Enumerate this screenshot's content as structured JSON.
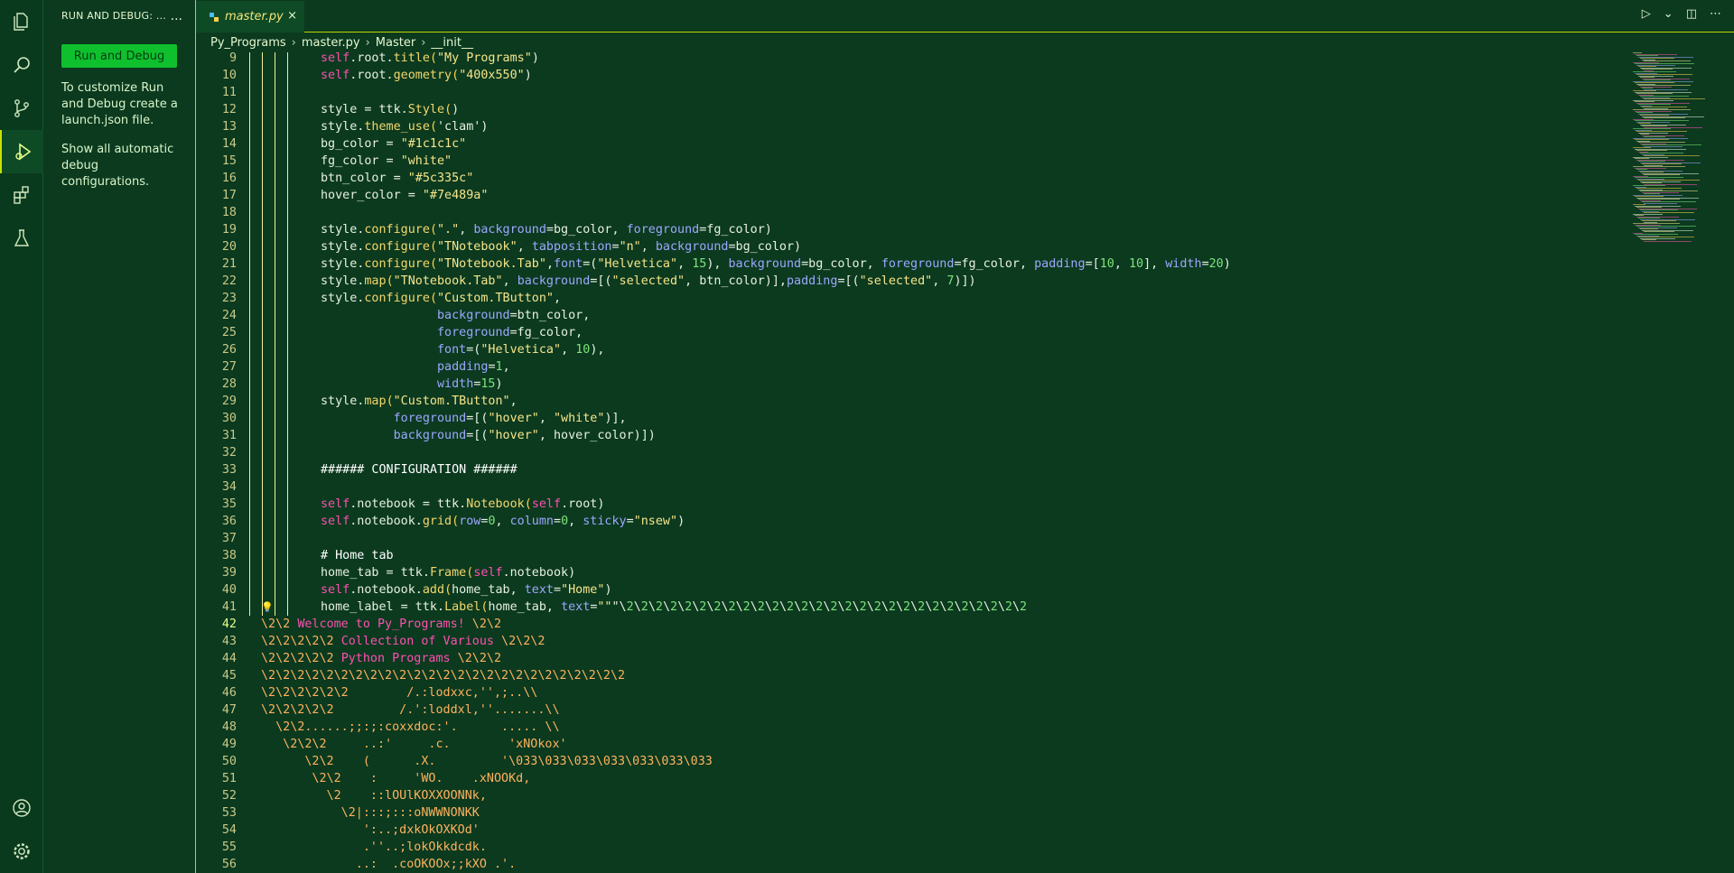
{
  "colors": {
    "accent": "#c2d400",
    "button": "#0fc02e",
    "background": "#0b3a1f"
  },
  "sidebar": {
    "header": "RUN AND DEBUG: ...",
    "more": "...",
    "run_button": "Run and Debug",
    "help_text": "To customize Run and Debug create a launch.json file.",
    "show_all": "Show all automatic debug configurations."
  },
  "tab": {
    "name": "master.py",
    "close": "×",
    "icon": "python-icon"
  },
  "breadcrumb": {
    "items": [
      "Py_Programs",
      "master.py",
      "Master",
      "__init__"
    ]
  },
  "editor": {
    "current_line": "42",
    "lines": [
      {
        "n": "9",
        "t": "self.root.title(\"My Programs\")"
      },
      {
        "n": "10",
        "t": "self.root.geometry(\"400x550\")"
      },
      {
        "n": "11",
        "t": ""
      },
      {
        "n": "12",
        "t": "style = ttk.Style()"
      },
      {
        "n": "13",
        "t": "style.theme_use('clam')"
      },
      {
        "n": "14",
        "t": "bg_color = \"#1c1c1c\""
      },
      {
        "n": "15",
        "t": "fg_color = \"white\""
      },
      {
        "n": "16",
        "t": "btn_color = \"#5c335c\""
      },
      {
        "n": "17",
        "t": "hover_color = \"#7e489a\""
      },
      {
        "n": "18",
        "t": ""
      },
      {
        "n": "19",
        "t": "style.configure(\".\", background=bg_color, foreground=fg_color)"
      },
      {
        "n": "20",
        "t": "style.configure(\"TNotebook\", tabposition=\"n\", background=bg_color)"
      },
      {
        "n": "21",
        "t": "style.configure(\"TNotebook.Tab\",font=(\"Helvetica\", 15), background=bg_color, foreground=fg_color, padding=[10, 10], width=20)"
      },
      {
        "n": "22",
        "t": "style.map(\"TNotebook.Tab\", background=[(\"selected\", btn_color)],padding=[(\"selected\", 7)])"
      },
      {
        "n": "23",
        "t": "style.configure(\"Custom.TButton\","
      },
      {
        "n": "24",
        "t": "                background=btn_color,"
      },
      {
        "n": "25",
        "t": "                foreground=fg_color,"
      },
      {
        "n": "26",
        "t": "                font=(\"Helvetica\", 10),"
      },
      {
        "n": "27",
        "t": "                padding=1,"
      },
      {
        "n": "28",
        "t": "                width=15)"
      },
      {
        "n": "29",
        "t": "style.map(\"Custom.TButton\","
      },
      {
        "n": "30",
        "t": "          foreground=[(\"hover\", \"white\")],"
      },
      {
        "n": "31",
        "t": "          background=[(\"hover\", hover_color)])"
      },
      {
        "n": "32",
        "t": ""
      },
      {
        "n": "33",
        "t": "###### CONFIGURATION ######"
      },
      {
        "n": "34",
        "t": ""
      },
      {
        "n": "35",
        "t": "self.notebook = ttk.Notebook(self.root)"
      },
      {
        "n": "36",
        "t": "self.notebook.grid(row=0, column=0, sticky=\"nsew\")"
      },
      {
        "n": "37",
        "t": ""
      },
      {
        "n": "38",
        "t": "# Home tab"
      },
      {
        "n": "39",
        "t": "home_tab = ttk.Frame(self.notebook)"
      },
      {
        "n": "40",
        "t": "self.notebook.add(home_tab, text=\"Home\")"
      },
      {
        "n": "41",
        "t": "home_label = ttk.Label(home_tab, text=\"\"\"\\2\\2\\2\\2\\2\\2\\2\\2\\2\\2\\2\\2\\2\\2\\2\\2\\2\\2\\2\\2\\2\\2\\2\\2\\2\\2\\2\\2"
      },
      {
        "n": "42",
        "t": "\\2\\2 Welcome to Py_Programs! \\2\\2"
      },
      {
        "n": "43",
        "t": "\\2\\2\\2\\2\\2 Collection of Various \\2\\2\\2"
      },
      {
        "n": "44",
        "t": "\\2\\2\\2\\2\\2 Python Programs \\2\\2\\2"
      },
      {
        "n": "45",
        "t": "\\2\\2\\2\\2\\2\\2\\2\\2\\2\\2\\2\\2\\2\\2\\2\\2\\2\\2\\2\\2\\2\\2\\2\\2\\2"
      },
      {
        "n": "46",
        "t": "\\2\\2\\2\\2\\2\\2        /.:lodxxc,'',;..\\\\"
      },
      {
        "n": "47",
        "t": "\\2\\2\\2\\2\\2         /.':loddxl,''.......\\\\"
      },
      {
        "n": "48",
        "t": "  \\2\\2......;;:;:coxxdoc:'.      ..... \\\\"
      },
      {
        "n": "49",
        "t": "   \\2\\2\\2     ..:'     .c.        'xNOkox'"
      },
      {
        "n": "50",
        "t": "      \\2\\2    (      .X.         '\\033\\033\\033\\033\\033\\033\\033"
      },
      {
        "n": "51",
        "t": "       \\2\\2    :     'WO.    .xNOOKd,"
      },
      {
        "n": "52",
        "t": "         \\2    ::lOUlKOXXOONNk,"
      },
      {
        "n": "53",
        "t": "           \\2|:::;:::oNWWNONKK"
      },
      {
        "n": "54",
        "t": "              ':..;dxkOkOXKOd'"
      },
      {
        "n": "55",
        "t": "              .''..;lokOkkdcdk."
      },
      {
        "n": "56",
        "t": "             ..:  .coOKOOx;;kXO .'."
      }
    ]
  }
}
